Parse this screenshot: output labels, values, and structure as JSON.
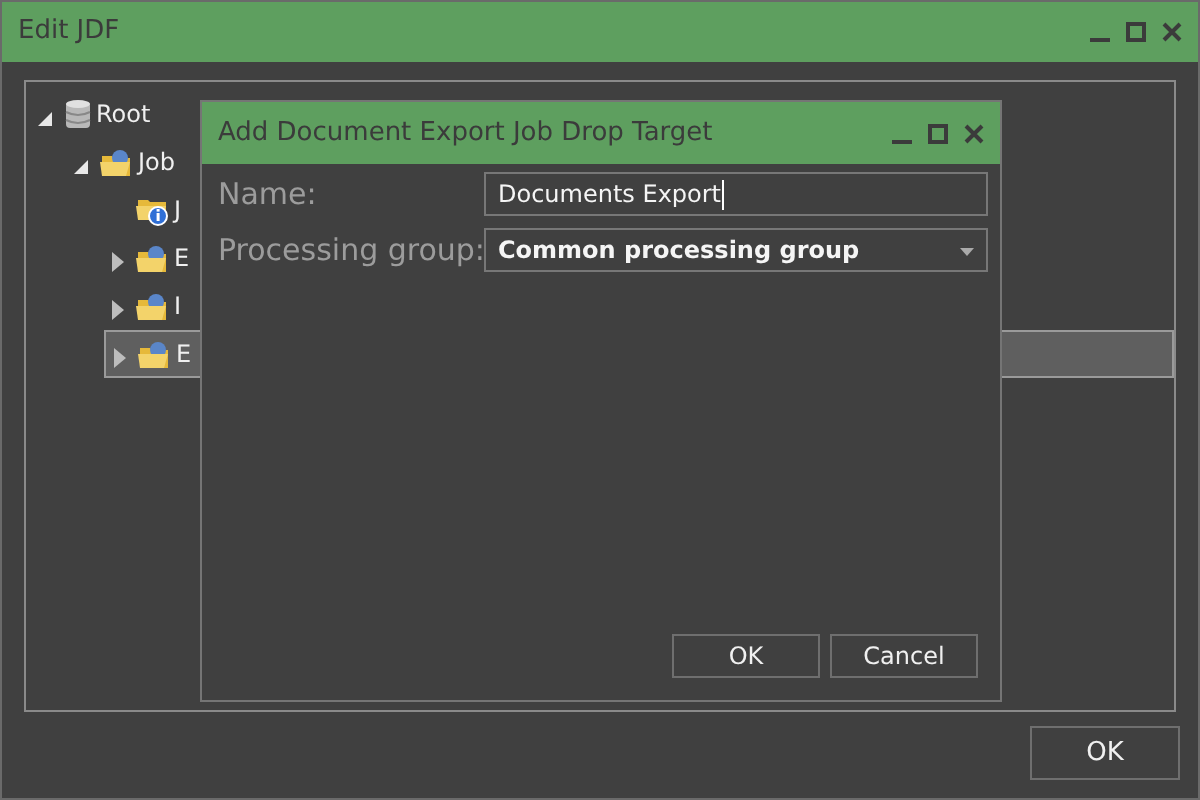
{
  "window": {
    "title": "Edit JDF"
  },
  "tree": [
    {
      "label": "Root",
      "kind": "database",
      "expanded": true,
      "selected": false,
      "children": [
        {
          "label": "Job",
          "kind": "folder",
          "expanded": true,
          "selected": false,
          "children": [
            {
              "label": "J",
              "kind": "info-folder",
              "selected": false
            },
            {
              "label": "E",
              "kind": "folder",
              "expanded": false,
              "selected": false
            },
            {
              "label": "I",
              "kind": "folder",
              "expanded": false,
              "selected": false
            },
            {
              "label": "E",
              "kind": "folder",
              "expanded": false,
              "selected": true
            }
          ]
        }
      ]
    }
  ],
  "dialog": {
    "title": "Add Document Export Job Drop Target",
    "fields": [
      {
        "label": "Name:",
        "kind": "text",
        "value": "Documents Export",
        "focused": true
      },
      {
        "label": "Processing group:",
        "kind": "select",
        "value": "Common processing group"
      }
    ],
    "buttons": [
      "OK",
      "Cancel"
    ]
  },
  "footer_buttons": [
    "OK"
  ]
}
